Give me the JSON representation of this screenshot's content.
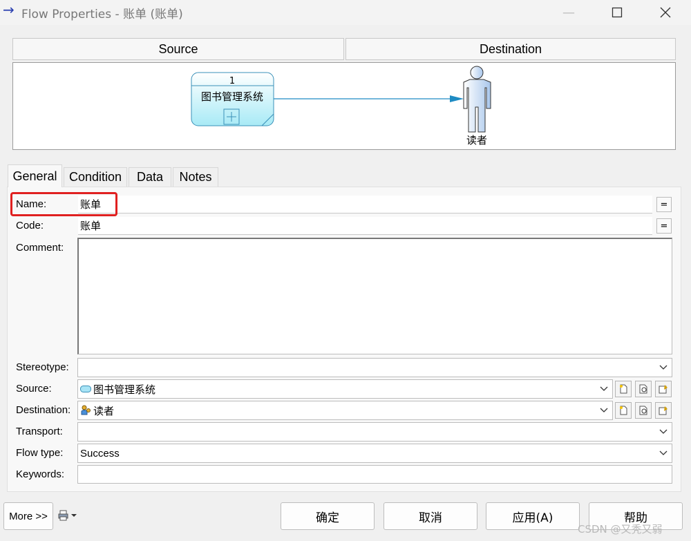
{
  "window": {
    "title": "Flow Properties - 账单 (账单)",
    "icon": "arrow-right-icon"
  },
  "headers": {
    "source": "Source",
    "destination": "Destination"
  },
  "diagram": {
    "process_number": "1",
    "process_name": "图书管理系统",
    "actor_name": "读者",
    "flow_color": "#1e8bc3"
  },
  "tabs": [
    "General",
    "Condition",
    "Data",
    "Notes"
  ],
  "form": {
    "name_label": "Name:",
    "name_value": "账单",
    "code_label": "Code:",
    "code_value": "账单",
    "comment_label": "Comment:",
    "comment_value": "",
    "stereotype_label": "Stereotype:",
    "stereotype_value": "",
    "source_label": "Source:",
    "source_value": "图书管理系统",
    "destination_label": "Destination:",
    "destination_value": "读者",
    "transport_label": "Transport:",
    "transport_value": "",
    "flowtype_label": "Flow type:",
    "flowtype_value": "Success",
    "keywords_label": "Keywords:",
    "keywords_value": "",
    "equals_glyph": "="
  },
  "buttons": {
    "more": "More >>",
    "ok": "确定",
    "cancel": "取消",
    "apply": "应用(A)",
    "help": "帮助"
  },
  "watermark": "CSDN @又秃又弱",
  "highlight_color": "#e02020"
}
